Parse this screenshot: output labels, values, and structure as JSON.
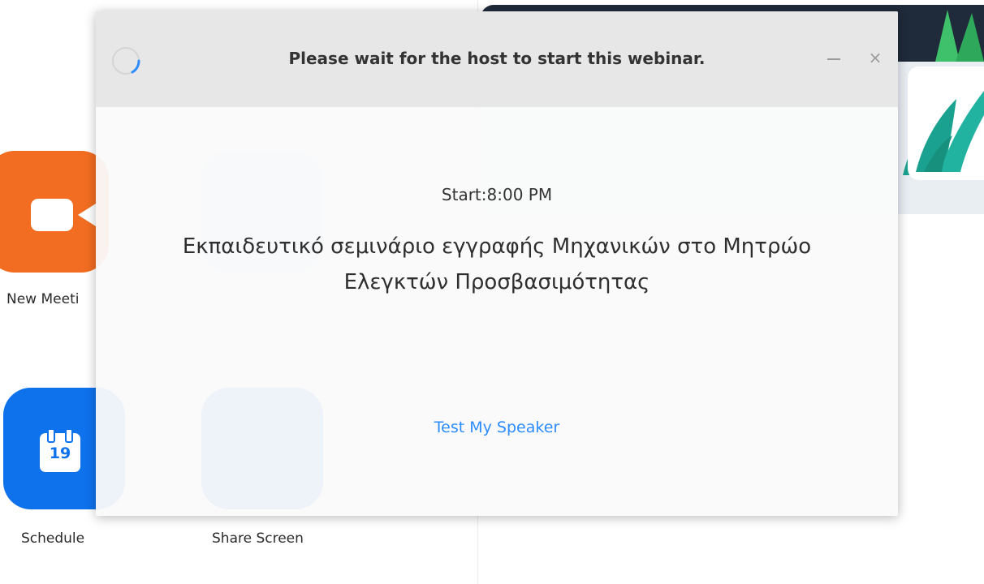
{
  "dialog": {
    "header_title": "Please wait for the host to start this webinar.",
    "start_time": "Start:8:00 PM",
    "webinar_title": "Εκπαιδευτικό σεμινάριο εγγραφής Μηχανικών στο Μητρώο Ελεγκτών Προσβασιμότητας",
    "test_speaker_label": "Test My Speaker",
    "minimize_icon": "minimize-icon",
    "close_icon": "close-icon",
    "close_glyph": "×"
  },
  "background": {
    "tiles": [
      {
        "label": "New Meeti",
        "icon": "video-camera-icon",
        "color": "#f26d21"
      },
      {
        "label": "",
        "icon": "join-icon",
        "color": "#0e72ed"
      },
      {
        "label": "Schedule",
        "icon": "calendar-icon",
        "color": "#0e72ed"
      },
      {
        "label": "Share Screen",
        "icon": "share-screen-icon",
        "color": "#0e72ed"
      }
    ],
    "calendar_day": "19"
  },
  "colors": {
    "accent_blue": "#2d8cff",
    "zoom_orange": "#f26d21",
    "zoom_blue": "#0e72ed",
    "header_gray": "#e7e7e7"
  }
}
